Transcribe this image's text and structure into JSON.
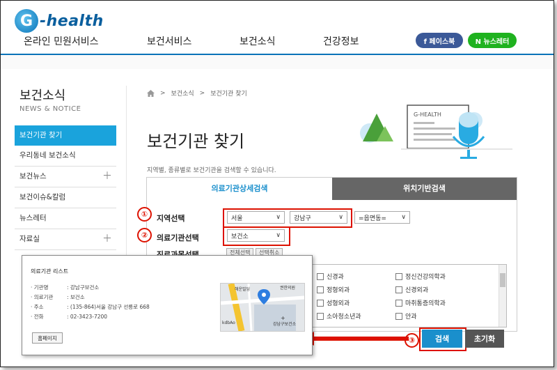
{
  "header": {
    "logo_letter": "G",
    "logo_text": "-health",
    "nav": [
      "온라인 민원서비스",
      "보건서비스",
      "보건소식",
      "건강정보"
    ],
    "sns_facebook": "f 페이스북",
    "sns_newsletter": "N 뉴스레터"
  },
  "sidebar": {
    "title": "보건소식",
    "subtitle": "NEWS & NOTICE",
    "items": [
      {
        "label": "보건기관 찾기",
        "active": true,
        "plus": false
      },
      {
        "label": "우리동네 보건소식",
        "active": false,
        "plus": false
      },
      {
        "label": "보건뉴스",
        "active": false,
        "plus": true
      },
      {
        "label": "보건이슈&칼럼",
        "active": false,
        "plus": false
      },
      {
        "label": "뉴스레터",
        "active": false,
        "plus": false
      },
      {
        "label": "자료실",
        "active": false,
        "plus": true
      }
    ]
  },
  "breadcrumb": [
    "보건소식",
    "보건기관 찾기"
  ],
  "main": {
    "title": "보건기관 찾기",
    "description": "지역별, 종류별로 보건기관을 검색할 수 있습니다.",
    "illustration_label": "G-HEALTH",
    "tabs": [
      "의료기관상세검색",
      "위치기반검색"
    ],
    "region_label": "지역선택",
    "institution_label": "의료기관선택",
    "department_label": "진료과목선택",
    "select_all": "전체선택",
    "deselect": "선택취소",
    "region_sido": "서울",
    "region_gu": "강남구",
    "region_dong": "=읍면동=",
    "institution_value": "보건소",
    "badges": [
      "①",
      "②",
      "③"
    ],
    "departments": [
      [
        "신경과",
        "정신건강의학과"
      ],
      [
        "정형외과",
        "신경외과"
      ],
      [
        "성형외과",
        "마취통증의학과"
      ],
      [
        "소아청소년과",
        "안과"
      ]
    ],
    "search_button": "검색",
    "reset_button": "초기화"
  },
  "popup": {
    "title": "의료기관 리스트",
    "rows": [
      {
        "key": "· 기관명",
        "value": ": 강남구보건소"
      },
      {
        "key": "· 의료기관",
        "value": ": 보건소"
      },
      {
        "key": "· 주소",
        "value": ": (135-864)서울 강남구 선릉로 668"
      },
      {
        "key": "· 전화",
        "value": ": 02-3423-7200"
      }
    ],
    "homepage_button": "홈페이지",
    "map_labels": [
      "해운빌딩",
      "권한의원",
      "강남구보건소",
      "kdbAo"
    ]
  }
}
